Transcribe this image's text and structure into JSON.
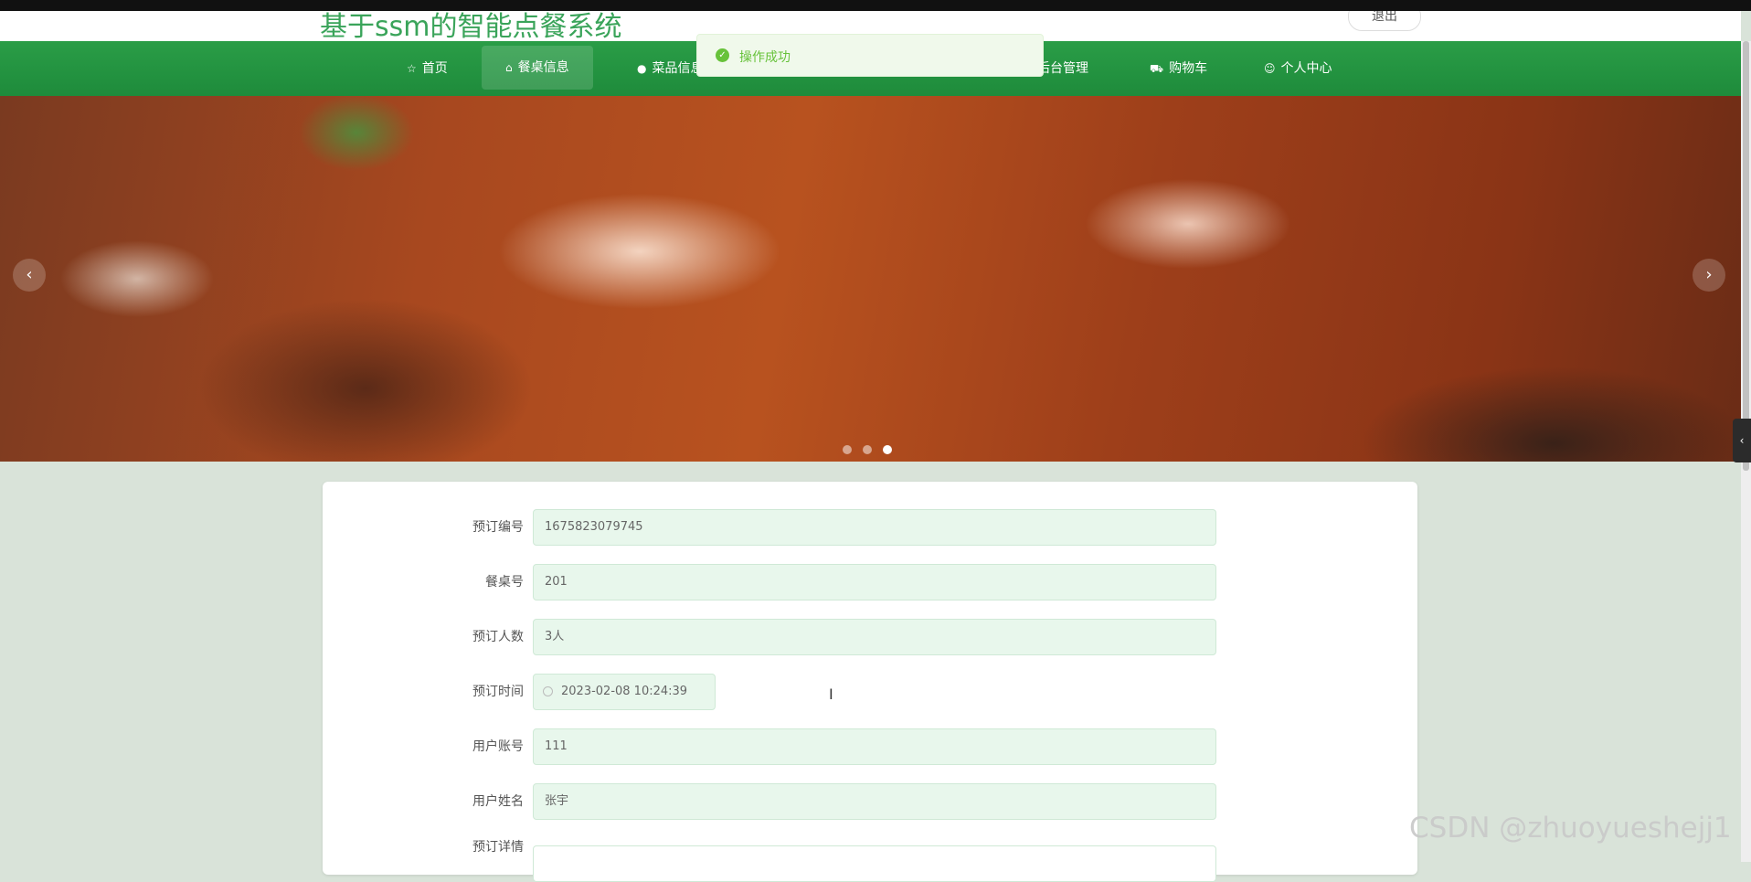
{
  "header": {
    "site_title": "基于ssm的智能点餐系统",
    "logout_label": "退出"
  },
  "nav": {
    "items": [
      {
        "label": "首页",
        "icon": "star-icon"
      },
      {
        "label": "餐桌信息",
        "icon": "bag-icon",
        "active": true
      },
      {
        "label": "菜品信息",
        "icon": "info-icon"
      },
      {
        "label": "后台管理",
        "icon": "none"
      },
      {
        "label": "购物车",
        "icon": "cart-icon"
      },
      {
        "label": "个人中心",
        "icon": "user-icon"
      }
    ]
  },
  "toast": {
    "message": "操作成功",
    "status_color": "#67c23a"
  },
  "carousel": {
    "prev_label": "‹",
    "next_label": "›",
    "slide_count": 3,
    "active_slide": 3
  },
  "form": {
    "fields": [
      {
        "label": "预订编号",
        "value": "1675823079745"
      },
      {
        "label": "餐桌号",
        "value": "201"
      },
      {
        "label": "预订人数",
        "value": "3人"
      },
      {
        "label": "预订时间",
        "value": "2023-02-08 10:24:39"
      },
      {
        "label": "用户账号",
        "value": "111"
      },
      {
        "label": "用户姓名",
        "value": "张宇"
      },
      {
        "label": "预订详情",
        "value": ""
      }
    ]
  },
  "watermark": "CSDN @zhuoyueshejj1",
  "colors": {
    "nav_green": "#1e8b3b",
    "title_green": "#3aa45a",
    "input_bg": "#e8f7ec"
  }
}
